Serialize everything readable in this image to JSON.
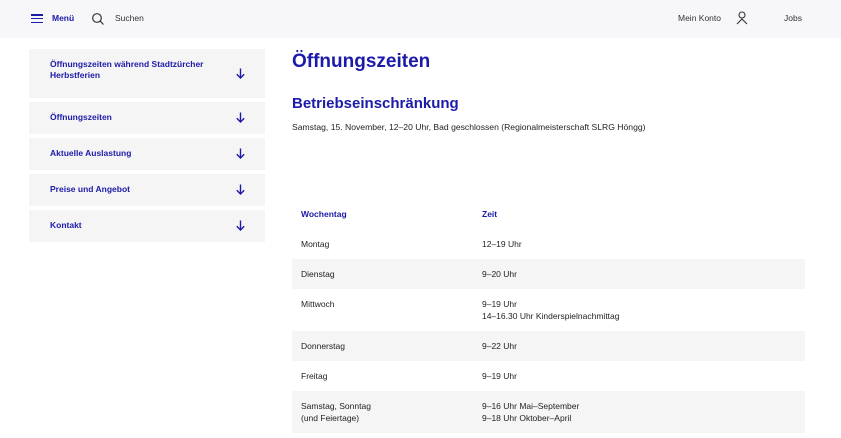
{
  "header": {
    "menu_label": "Menü",
    "search_label": "Suchen",
    "account_label": "Mein Konto",
    "jobs_label": "Jobs"
  },
  "sidebar": {
    "items": [
      {
        "label": "Öffnungszeiten während Stadtzürcher Herbstferien"
      },
      {
        "label": "Öffnungszeiten"
      },
      {
        "label": "Aktuelle Auslastung"
      },
      {
        "label": "Preise und Angebot"
      },
      {
        "label": "Kontakt"
      }
    ]
  },
  "main": {
    "title": "Öffnungszeiten",
    "subtitle": "Betriebseinschränkung",
    "notice": "Samstag, 15. November, 12–20 Uhr, Bad geschlossen (Regionalmeisterschaft SLRG Höngg)"
  },
  "table": {
    "headers": [
      "Wochentag",
      "Zeit"
    ],
    "rows": [
      {
        "day": "Montag",
        "time": "12–19 Uhr",
        "time2": ""
      },
      {
        "day": "Dienstag",
        "time": "9–20 Uhr",
        "time2": ""
      },
      {
        "day": "Mittwoch",
        "time": "9–19 Uhr",
        "time2": "14–16.30 Uhr Kinderspielnachmittag"
      },
      {
        "day": "Donnerstag",
        "time": "9–22 Uhr",
        "time2": ""
      },
      {
        "day": "Freitag",
        "time": "9–19 Uhr",
        "time2": ""
      },
      {
        "day": "Samstag, Sonntag",
        "day2": "(und Feiertage)",
        "time": "9–16 Uhr Mai–September",
        "time2": "9–18 Uhr Oktober–April"
      }
    ]
  },
  "colors": {
    "accent": "#1c1aa8",
    "row_alt": "#f5f5f5",
    "header_bg": "#f7f7f9"
  },
  "icons": {
    "menu": "hamburger-icon",
    "search": "search-icon",
    "account": "user-icon",
    "expand": "arrow-down-icon"
  }
}
